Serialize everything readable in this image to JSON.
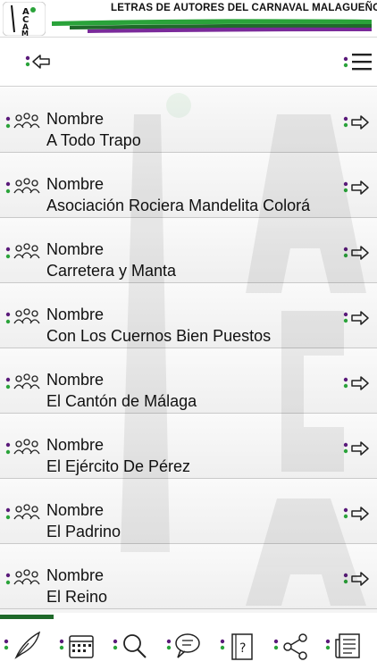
{
  "header": {
    "logo_letters": "ACAM",
    "title": "LETRAS DE AUTORES DEL CARNAVAL MALAGUEÑO"
  },
  "toolbar": {
    "back_icon": "back-arrow-icon",
    "menu_icon": "hamburger-menu-icon"
  },
  "list": {
    "items": [
      {
        "label": "Nombre",
        "value": "A Todo Trapo"
      },
      {
        "label": "Nombre",
        "value": "Asociación Rociera Mandelita Colorá"
      },
      {
        "label": "Nombre",
        "value": "Carretera y Manta"
      },
      {
        "label": "Nombre",
        "value": "Con Los Cuernos Bien Puestos"
      },
      {
        "label": "Nombre",
        "value": "El Cantón de Málaga"
      },
      {
        "label": "Nombre",
        "value": "El Ejército De Pérez"
      },
      {
        "label": "Nombre",
        "value": "El Padrino"
      },
      {
        "label": "Nombre",
        "value": "El Reino"
      }
    ],
    "row_icon": "group-icon",
    "arrow_icon": "forward-arrow-icon"
  },
  "bottom_nav": {
    "tabs": [
      {
        "icon": "quill-icon"
      },
      {
        "icon": "calendar-icon"
      },
      {
        "icon": "search-icon"
      },
      {
        "icon": "chat-icon"
      },
      {
        "icon": "help-icon"
      },
      {
        "icon": "share-icon"
      },
      {
        "icon": "news-icon"
      }
    ]
  },
  "colors": {
    "green": "#2aa33a",
    "purple": "#5a1a7a",
    "dark_green": "#1f6a2a"
  }
}
